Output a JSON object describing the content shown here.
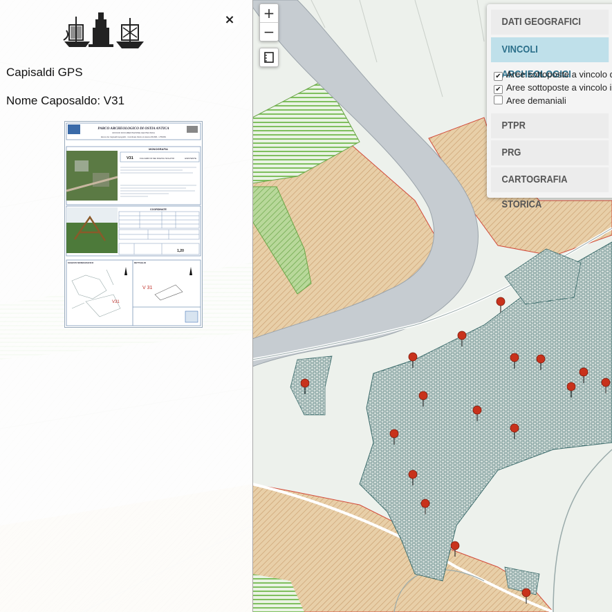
{
  "panel": {
    "title": "Capisaldi GPS",
    "subtitle": "Nome Caposaldo: V31",
    "close_label": "×"
  },
  "card": {
    "header": "PARCO ARCHEOLOGICO DI OSTIA ANTICA",
    "header_sub": "UFFICIO DOCUMENTAZIONE GEOTECNICA",
    "header_line": "Elenco dei Capisaldi topografici - Coordinate riferite al sistema WGS84 - UTM33N",
    "monografia_title": "MONOGRAFIA",
    "point_name": "V31",
    "point_desc": "FULCHRO DI SEI DIAVOLI SOLATIO",
    "point_status": "ESISTENTE",
    "coord_title": "COORDINATE",
    "schizzo_title": "SCHIZZO MONOGRAFICO",
    "dettaglio_title": "DETTAGLIO",
    "sketch_label": "V 31",
    "sketch_label2": "V31",
    "value_box": "1,20"
  },
  "controls": {
    "zoom_in": "+",
    "zoom_out": "−"
  },
  "layers": {
    "sections": [
      {
        "label": "DATI GEOGRAFICI",
        "active": false
      },
      {
        "label": "VINCOLI ARCHEOLOGICI",
        "active": true
      },
      {
        "label": "PTPR",
        "active": false
      },
      {
        "label": "PRG",
        "active": false
      },
      {
        "label": "CARTOGRAFIA STORICA",
        "active": false
      }
    ],
    "checks": [
      {
        "label": "Aree sottoposte a vincolo d",
        "checked": true
      },
      {
        "label": "Aree sottoposte a vincolo i",
        "checked": true
      },
      {
        "label": "Aree demaniali",
        "checked": false
      }
    ]
  },
  "colors": {
    "river": "#c6ccd1",
    "archeo_fill": "#e6c9a0",
    "archeo_line": "#d24a3a",
    "green_hatch": "#7fbf5e",
    "roads": "#3f6d6d",
    "active_section": "#bfe0ea",
    "marker": "#c8321c"
  },
  "markers_count_label": ""
}
